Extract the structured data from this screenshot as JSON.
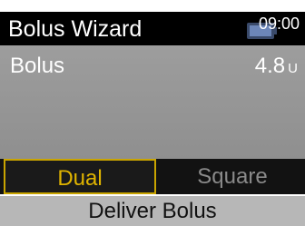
{
  "header": {
    "title": "Bolus Wizard",
    "time": "09:00",
    "battery_icon": "battery-icon"
  },
  "bolus": {
    "label": "Bolus",
    "value": "4.8",
    "unit": "U"
  },
  "tabs": [
    {
      "label": "Dual",
      "selected": true
    },
    {
      "label": "Square",
      "selected": false
    }
  ],
  "footer": {
    "deliver_label": "Deliver Bolus"
  },
  "colors": {
    "selected_tab_text": "#e0b400",
    "selected_tab_border": "#c9a400",
    "panel": "#9a9a9a"
  }
}
